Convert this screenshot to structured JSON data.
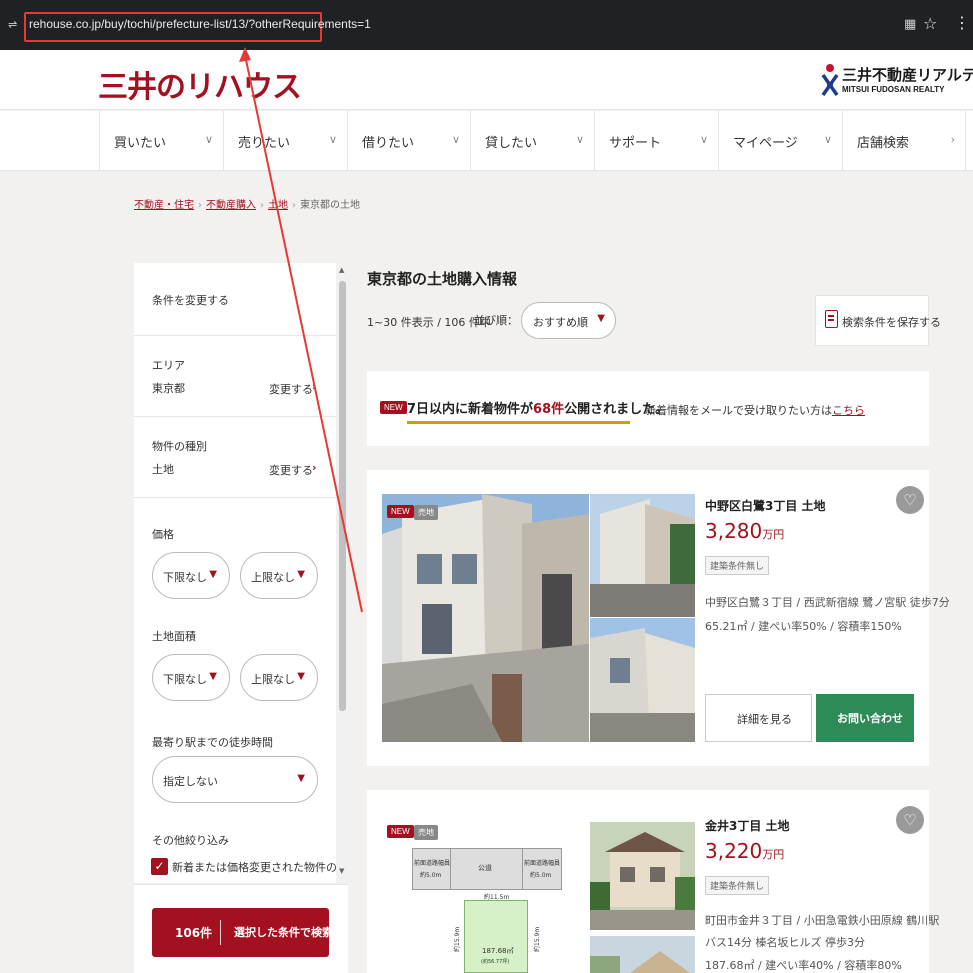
{
  "browser": {
    "url": "rehouse.co.jp/buy/tochi/prefecture-list/13/?otherRequirements=1",
    "tune_icon": "⇌",
    "qr_icon": "▦",
    "star_icon": "☆",
    "menu_icon": "⋮"
  },
  "header": {
    "logo_text": "三井のリハウス",
    "partner_logo_jp": "三井不動産リアルティ",
    "partner_logo_en": "MITSUI FUDOSAN REALTY"
  },
  "nav": {
    "items": [
      {
        "label": "買いたい",
        "chevron": "∨"
      },
      {
        "label": "売りたい",
        "chevron": "∨"
      },
      {
        "label": "借りたい",
        "chevron": "∨"
      },
      {
        "label": "貸したい",
        "chevron": "∨"
      },
      {
        "label": "サポート",
        "chevron": "∨"
      },
      {
        "label": "マイページ",
        "chevron": "∨"
      },
      {
        "label": "店舗検索",
        "chevron": "›"
      }
    ]
  },
  "breadcrumb": {
    "items": [
      "不動産・住宅",
      "不動産購入",
      "土地"
    ],
    "separator": "›",
    "current": "東京都の土地"
  },
  "sidebar": {
    "change_conditions": "条件を変更する",
    "area": {
      "label": "エリア",
      "value": "東京都",
      "change": "変更する",
      "arrow": "›"
    },
    "type": {
      "label": "物件の種別",
      "value": "土地",
      "change": "変更する",
      "arrow": "›"
    },
    "price": {
      "label": "価格",
      "min": "下限なし",
      "max": "上限なし"
    },
    "land_area": {
      "label": "土地面積",
      "min": "下限なし",
      "max": "上限なし"
    },
    "walk": {
      "label": "最寄り駅までの徒歩時間",
      "value": "指定しない"
    },
    "other": {
      "label": "その他絞り込み",
      "checkbox_label": "新着または価格変更された物件のみ",
      "checked": true
    },
    "search_count": "106件",
    "search_button": "選択した条件で検索"
  },
  "main": {
    "title": "東京都の土地購入情報",
    "count_text": "1~30 件表示 / 106 件中",
    "sort_label": "並び順：",
    "sort_value": "おすすめ順",
    "save_button": "検索条件を保存する",
    "notice": {
      "badge": "NEW",
      "text_pre": "7日以内に新着物件が",
      "count": "68件",
      "text_post": "公開されました。",
      "mail_text": "新着情報をメールで受け取りたい方は",
      "mail_link": "こちら"
    },
    "listings": [
      {
        "badge_new": "NEW",
        "badge_type": "売地",
        "title": "中野区白鷺3丁目 土地",
        "price": "3,280",
        "price_unit": "万円",
        "tag": "建築条件無し",
        "address": "中野区白鷺３丁目 / 西武新宿線 鷺ノ宮駅 徒歩7分",
        "spec": "65.21㎡ / 建ぺい率50% / 容積率150%",
        "detail_button": "詳細を見る",
        "inquiry_button": "お問い合わせ",
        "fav_icon": "♡"
      },
      {
        "badge_new": "NEW",
        "badge_type": "売地",
        "title": "金井3丁目 土地",
        "price": "3,220",
        "price_unit": "万円",
        "tag": "建築条件無し",
        "address": "町田市金井３丁目 / 小田急電鉄小田原線 鶴川駅",
        "address2": "バス14分 榛名坂ヒルズ 停歩3分",
        "spec": "187.68㎡ / 建ぺい率40% / 容積率80%",
        "fav_icon": "♡",
        "plan": {
          "front_road_left": "前面道路幅員",
          "front_road_left_val": "約5.0m",
          "public_road": "公道",
          "front_road_right": "前面道路幅員",
          "front_road_right_val": "約5.0m",
          "frontage": "約11.5m",
          "area": "187.68㎡",
          "area_tsubo": "(約56.77坪)",
          "side_left": "約15.9m",
          "side_right": "約15.9m"
        }
      }
    ]
  }
}
